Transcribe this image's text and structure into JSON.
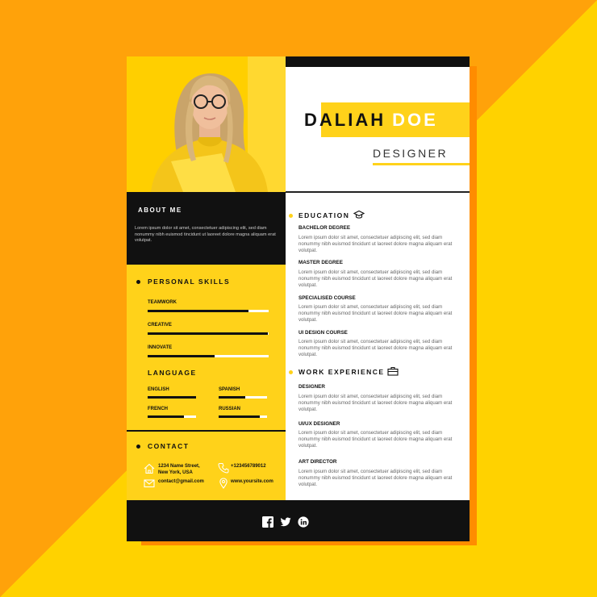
{
  "resume": {
    "first_name": "DALIAH",
    "last_name": "DOE",
    "role": "DESIGNER",
    "about": {
      "title": "ABOUT ME",
      "text": "Lorem ipsum dolor sit amet, consectetuer adipiscing elit, sed diam nonummy nibh euismod tincidunt ut laoreet dolore magna aliquam erat volutpat."
    },
    "skills": {
      "title": "PERSONAL SKILLS",
      "items": [
        {
          "label": "TEAMWORK",
          "level": 0.83
        },
        {
          "label": "CREATIVE",
          "level": 0.99
        },
        {
          "label": "INNOVATE",
          "level": 0.55
        }
      ]
    },
    "language": {
      "title": "LANGUAGE",
      "items": [
        {
          "label": "ENGLISH",
          "level": 1.0
        },
        {
          "label": "SPANISH",
          "level": 0.55
        },
        {
          "label": "FRENCH",
          "level": 0.75
        },
        {
          "label": "RUSSIAN",
          "level": 0.85
        }
      ]
    },
    "contact": {
      "title": "CONTACT",
      "address_line1": "1234 Name Street,",
      "address_line2": "New York, USA",
      "phone": "+123456789012",
      "email": "contact@gmail.com",
      "website": "www.yoursite.com"
    },
    "education": {
      "title": "EDUCATION",
      "entries": [
        {
          "title": "BACHELOR DEGREE",
          "text": "Lorem ipsum dolor sit amet, consectetuer adipiscing elit, sed diam nonummy nibh euismod tincidunt ut laoreet dolore magna aliquam erat volutpat."
        },
        {
          "title": "MASTER DEGREE",
          "text": "Lorem ipsum dolor sit amet, consectetuer adipiscing elit, sed diam nonummy nibh euismod tincidunt ut laoreet dolore magna aliquam erat volutpat."
        },
        {
          "title": "SPECIALISED COURSE",
          "text": "Lorem ipsum dolor sit amet, consectetuer adipiscing elit, sed diam nonummy nibh euismod tincidunt ut laoreet dolore magna aliquam erat volutpat."
        },
        {
          "title": "UI DESIGN COURSE",
          "text": "Lorem ipsum dolor sit amet, consectetuer adipiscing elit, sed diam nonummy nibh euismod tincidunt ut laoreet dolore magna aliquam erat volutpat."
        }
      ]
    },
    "work": {
      "title": "WORK EXPERIENCE",
      "entries": [
        {
          "title": "DESIGNER",
          "text": "Lorem ipsum dolor sit amet, consectetuer adipiscing elit, sed diam nonummy nibh euismod tincidunt ut laoreet dolore magna aliquam erat volutpat."
        },
        {
          "title": "UI/UX DESIGNER",
          "text": "Lorem ipsum dolor sit amet, consectetuer adipiscing elit, sed diam nonummy nibh euismod tincidunt ut laoreet dolore magna aliquam erat volutpat."
        },
        {
          "title": "ART DIRECTOR",
          "text": "Lorem ipsum dolor sit amet, consectetuer adipiscing elit, sed diam nonummy nibh euismod tincidunt ut laoreet dolore magna aliquam erat volutpat."
        }
      ]
    },
    "social_icons": [
      "facebook-icon",
      "twitter-icon",
      "linkedin-icon"
    ]
  },
  "colors": {
    "accent": "#FFD21A",
    "dark": "#111111",
    "background_orange": "#FFA20A",
    "background_yellow": "#FFD200"
  }
}
